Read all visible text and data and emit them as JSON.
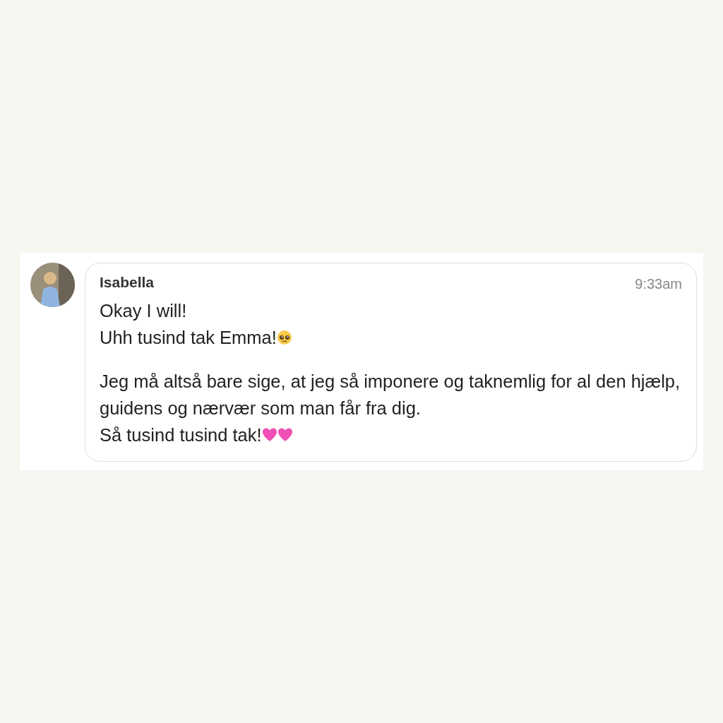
{
  "comment": {
    "author": "Isabella",
    "time": "9:33am",
    "paragraphs": [
      {
        "lines": [
          {
            "text": "Okay I will!",
            "kind": "plain"
          },
          {
            "text": "Uhh tusind tak Emma!",
            "kind": "face"
          }
        ]
      },
      {
        "lines": [
          {
            "text": "Jeg må altså bare sige, at jeg så imponere og taknemlig for al den hjælp, guidens og nærvær som man får fra dig.",
            "kind": "plain"
          },
          {
            "text": "Så tusind tusind tak!",
            "kind": "hearts"
          }
        ]
      }
    ]
  }
}
